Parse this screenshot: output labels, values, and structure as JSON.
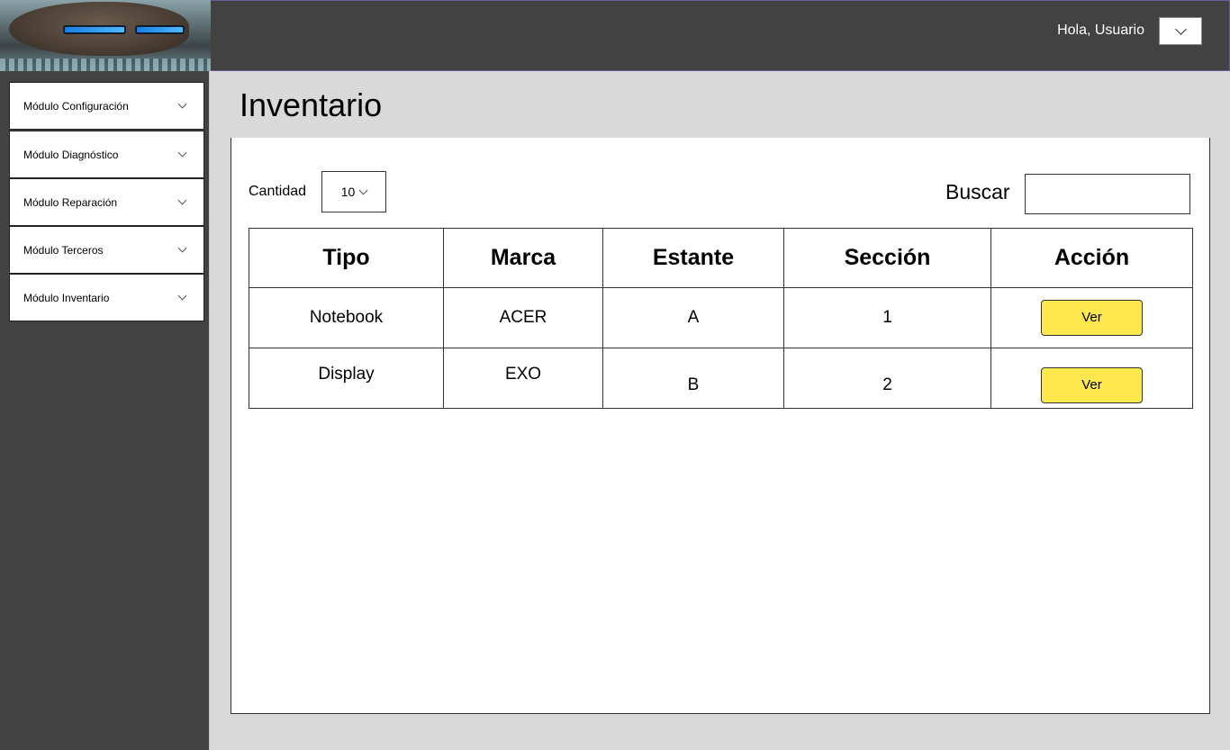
{
  "header": {
    "greeting": "Hola, Usuario",
    "user_menu_icon": "chevron-down-icon"
  },
  "sidebar": {
    "items": [
      {
        "label": "Módulo Configuración"
      },
      {
        "label": "Módulo Diagnóstico"
      },
      {
        "label": "Módulo Reparación"
      },
      {
        "label": "Módulo Terceros"
      },
      {
        "label": "Módulo Inventario"
      }
    ]
  },
  "main": {
    "title": "Inventario",
    "quantity_label": "Cantidad",
    "quantity_value": "10",
    "search_label": "Buscar",
    "search_value": "",
    "table": {
      "headers": [
        "Tipo",
        "Marca",
        "Estante",
        "Sección",
        "Acción"
      ],
      "rows": [
        {
          "tipo": "Notebook",
          "marca": "ACER",
          "estante": "A",
          "seccion": "1",
          "accion": "Ver"
        },
        {
          "tipo": "Display",
          "marca": "EXO",
          "estante": "B",
          "seccion": "2",
          "accion": "Ver"
        }
      ]
    }
  },
  "colors": {
    "topbar": "#424242",
    "sidebar": "#424242",
    "content_bg": "#d9d9d9",
    "action_button": "#ffe84d"
  }
}
